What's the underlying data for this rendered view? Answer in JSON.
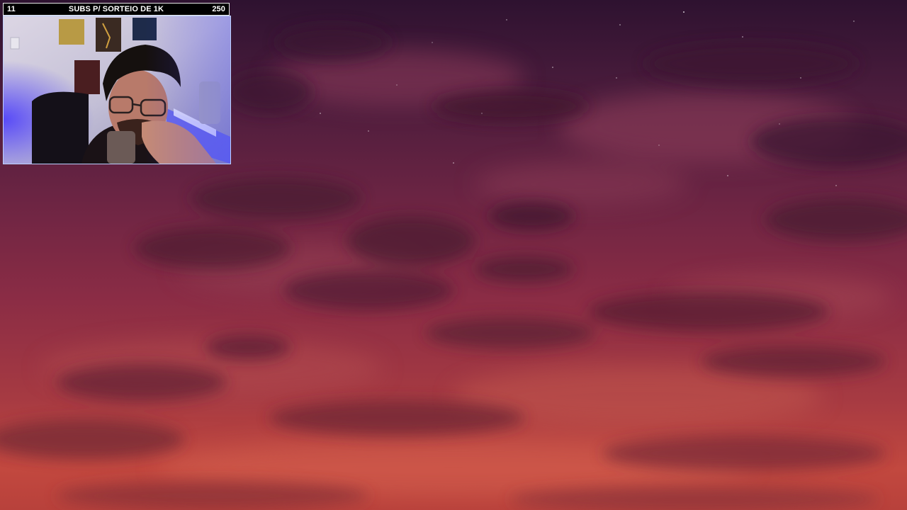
{
  "overlay": {
    "sub_goal": {
      "current": "11",
      "title": "SUBS P/ SORTEIO DE 1K",
      "target": "250"
    }
  },
  "colors": {
    "goal_bar_bg": "#000000",
    "goal_bar_text": "#ffffff",
    "sky_top": "#2e1230",
    "sky_bottom": "#c2483f",
    "webcam_light": "#3b3fff"
  },
  "icons": {
    "background": "sunset-sky-clouds-image",
    "webcam": "webcam-feed-image"
  }
}
